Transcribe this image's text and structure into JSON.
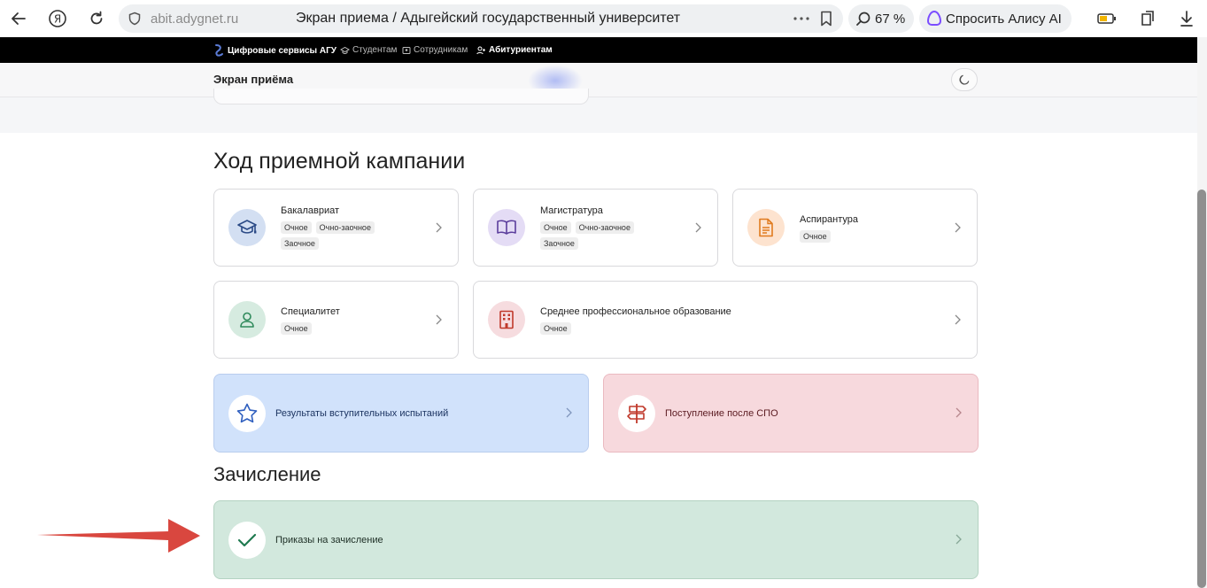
{
  "browser": {
    "url": "abit.adygnet.ru",
    "tab_title": "Экран приема / Адыгейский государственный университет",
    "zoom": "67 %",
    "alice_label": "Спросить Алису AI"
  },
  "topbar": {
    "brand": "Цифровые сервисы АГУ",
    "students": "Студентам",
    "staff": "Сотрудникам",
    "applicants": "Абитуриентам"
  },
  "header": {
    "title": "Экран приёма"
  },
  "campaign": {
    "title": "Ход приемной кампании",
    "cards": [
      {
        "title": "Бакалавриат",
        "tags": [
          "Очное",
          "Очно-заочное",
          "Заочное"
        ]
      },
      {
        "title": "Магистратура",
        "tags": [
          "Очное",
          "Очно-заочное",
          "Заочное"
        ]
      },
      {
        "title": "Аспирантура",
        "tags": [
          "Очное"
        ]
      },
      {
        "title": "Специалитет",
        "tags": [
          "Очное"
        ]
      },
      {
        "title": "Среднее профессиональное образование",
        "tags": [
          "Очное"
        ]
      }
    ],
    "results_label": "Результаты вступительных испытаний",
    "after_spo_label": "Поступление после СПО"
  },
  "enrollment": {
    "title": "Зачисление",
    "orders_label": "Приказы на зачисление"
  },
  "colors": {
    "blue_card": "#d1e2fb",
    "red_card": "#f7d9dd",
    "green_card": "#d2e8dd",
    "arrow": "#d9473f"
  }
}
